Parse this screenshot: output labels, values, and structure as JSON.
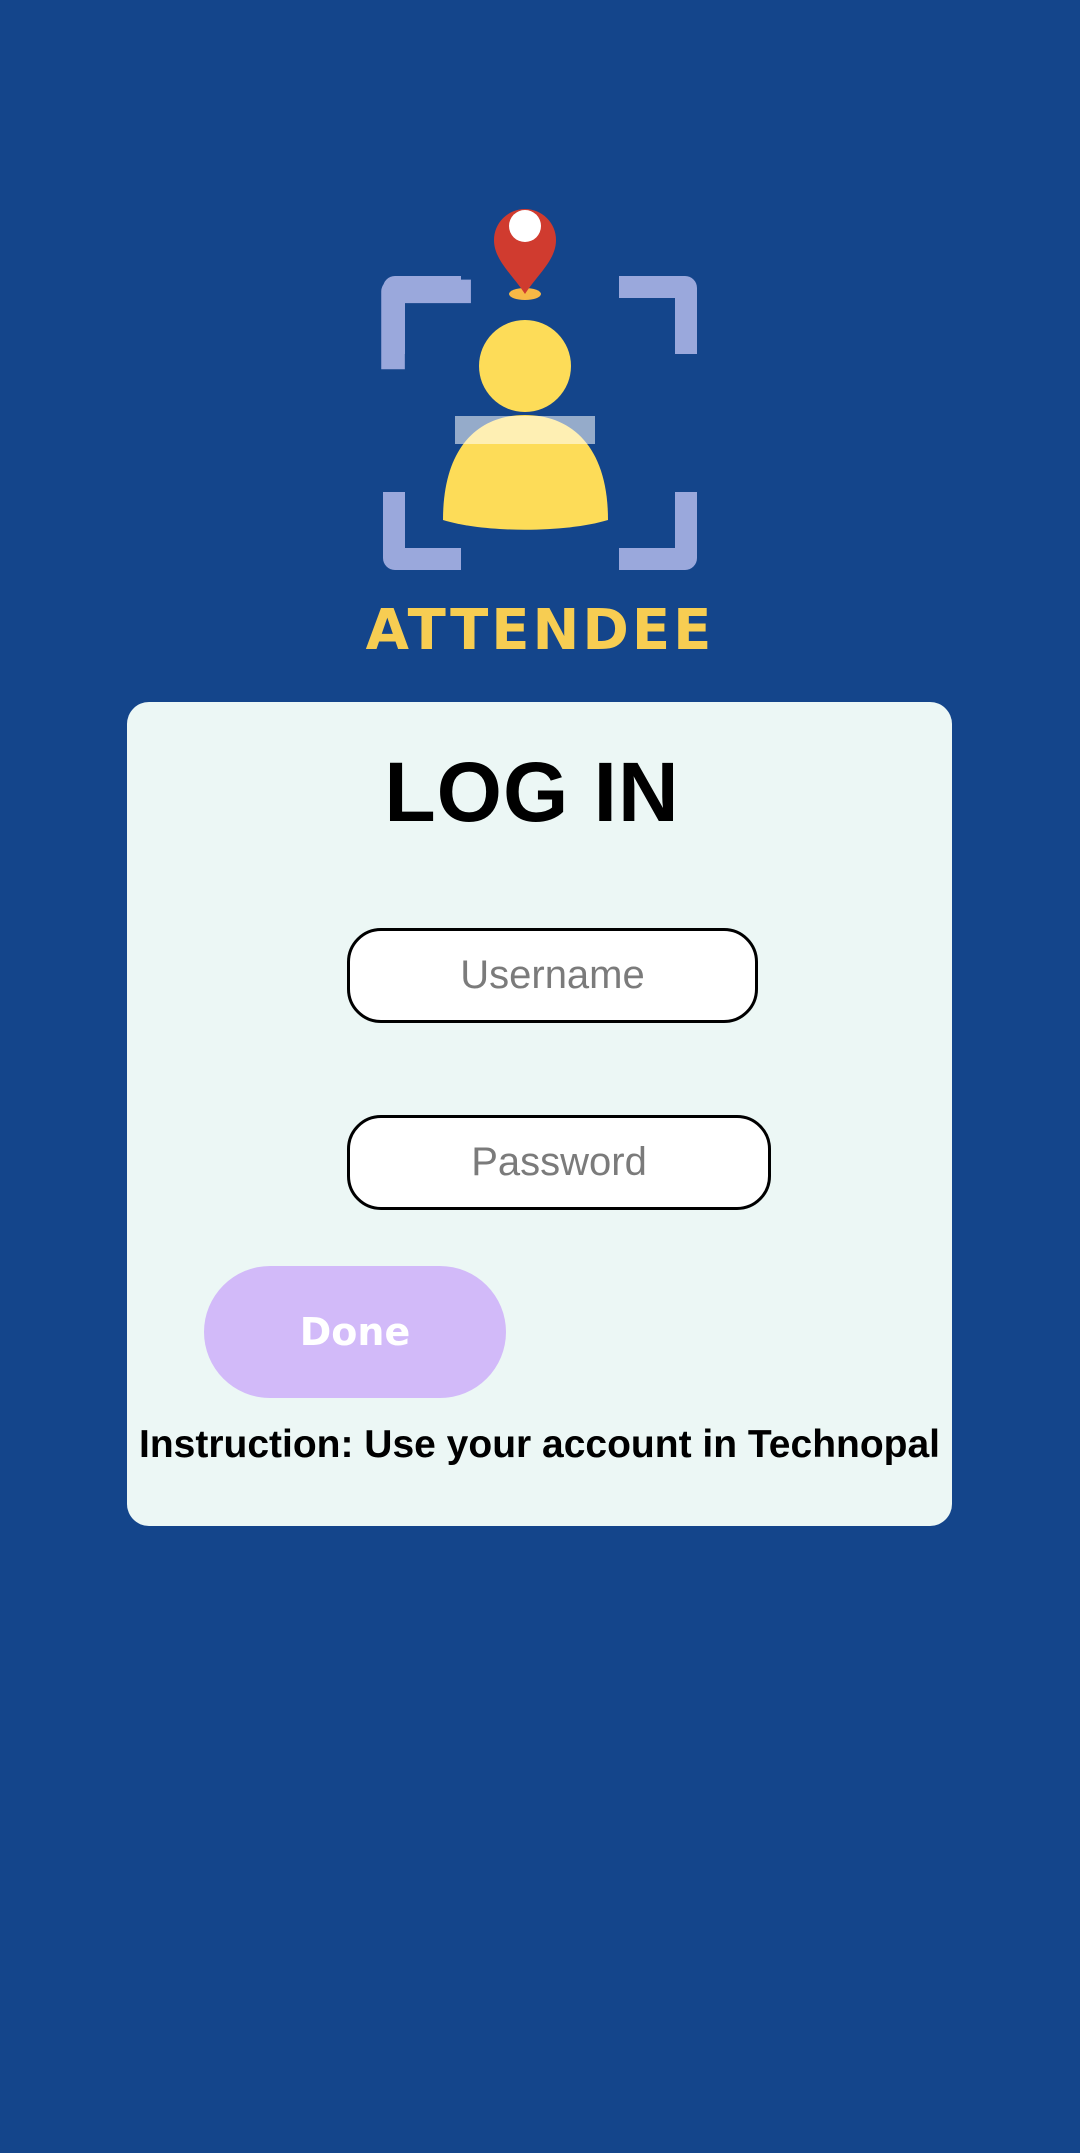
{
  "app": {
    "brand_name": "ATTENDEE",
    "logo_icon": "attendee-logo-icon"
  },
  "login": {
    "title": "LOG IN",
    "username_placeholder": "Username",
    "password_placeholder": "Password",
    "done_label": "Done",
    "instruction": "Instruction: Use your account in Technopal"
  },
  "colors": {
    "background": "#14458b",
    "card": "#ecf7f5",
    "brand_yellow": "#f7cd52",
    "pin_red": "#d03b2f",
    "frame_lavender": "#9aa8dc",
    "done_button": "#d2baf9"
  }
}
